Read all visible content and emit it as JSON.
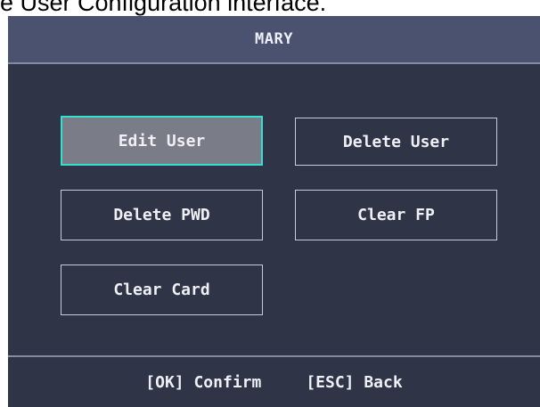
{
  "caption": "e User Configuration interface.",
  "title": "MARY",
  "menu": {
    "edit_user": "Edit User",
    "delete_user": "Delete User",
    "delete_pwd": "Delete PWD",
    "clear_fp": "Clear FP",
    "clear_card": "Clear Card",
    "selected": "Edit User"
  },
  "footer": {
    "confirm": "[OK] Confirm",
    "back": "[ESC] Back"
  },
  "colors": {
    "screen_background": "#2f3447",
    "title_bar": "#4a5270",
    "selection_border": "#33e0d0",
    "selection_fill": "#7a7d88"
  }
}
